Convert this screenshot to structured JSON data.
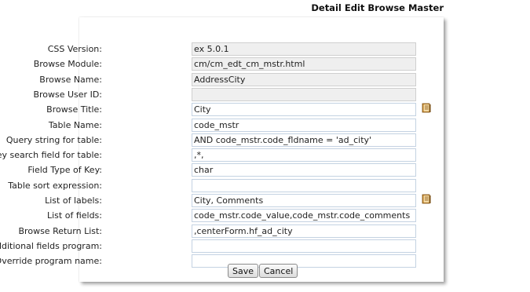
{
  "header": {
    "title": "Detail Edit Browse Master"
  },
  "fields": [
    {
      "label": "CSS Version:",
      "value": "ex 5.0.1",
      "readonly": true
    },
    {
      "label": "Browse Module:",
      "value": "cm/cm_edt_cm_mstr.html",
      "readonly": true
    },
    {
      "label": "Browse Name:",
      "value": "AddressCity",
      "readonly": true
    },
    {
      "label": "Browse User ID:",
      "value": "",
      "readonly": true
    },
    {
      "label": "Browse Title:",
      "value": "City",
      "readonly": false,
      "icon": "book-icon"
    },
    {
      "label": "Table Name:",
      "value": "code_mstr",
      "readonly": false
    },
    {
      "label": "Query string for table:",
      "value": "AND code_mstr.code_fldname = 'ad_city'",
      "readonly": false
    },
    {
      "label": "Key search field for table:",
      "value": ",*,",
      "readonly": false
    },
    {
      "label": "Field Type of Key:",
      "value": "char",
      "readonly": false
    },
    {
      "label": "Table sort expression:",
      "value": "",
      "readonly": false
    },
    {
      "label": "List of labels:",
      "value": "City, Comments",
      "readonly": false,
      "icon": "book-icon"
    },
    {
      "label": "List of fields:",
      "value": "code_mstr.code_value,code_mstr.code_comments",
      "readonly": false
    },
    {
      "label": "Browse Return List:",
      "value": ",centerForm.hf_ad_city",
      "readonly": false
    },
    {
      "label": "Additional fields program:",
      "value": "",
      "readonly": false
    },
    {
      "label": "Override program name:",
      "value": "",
      "readonly": false
    }
  ],
  "buttons": {
    "save": "Save",
    "cancel": "Cancel"
  }
}
